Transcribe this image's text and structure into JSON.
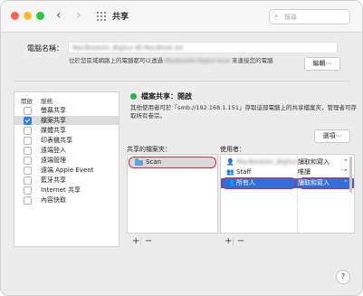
{
  "toolbar": {
    "title": "共享",
    "back_glyph": "‹",
    "forward_glyph": "›",
    "search_placeholder": "搜尋"
  },
  "computer_name": {
    "label": "電腦名稱：",
    "value": "MacBookAir_BigSur 的 MacBook Air",
    "description_prefix": "位於您區域網路上的電腦都可以透過",
    "hostname": "MacBookAir-BigSur.local",
    "description_suffix": "來連接您的電腦",
    "edit_button": "編輯⋯"
  },
  "services": {
    "header_on": "開啟",
    "header_service": "服務",
    "items": [
      {
        "label": "螢幕共享",
        "checked": false,
        "selected": false
      },
      {
        "label": "檔案共享",
        "checked": true,
        "selected": true
      },
      {
        "label": "媒體共享",
        "checked": false,
        "selected": false
      },
      {
        "label": "印表機共享",
        "checked": false,
        "selected": false
      },
      {
        "label": "遠端登入",
        "checked": false,
        "selected": false
      },
      {
        "label": "遠端管理",
        "checked": false,
        "selected": false
      },
      {
        "label": "遠端 Apple Event",
        "checked": false,
        "selected": false
      },
      {
        "label": "藍牙共享",
        "checked": false,
        "selected": false
      },
      {
        "label": "Internet 共享",
        "checked": false,
        "selected": false
      },
      {
        "label": "內容快取",
        "checked": false,
        "selected": false
      }
    ]
  },
  "status": {
    "text": "檔案共享：開啟",
    "description": "其他使用者可於「smb://192.168.1.151」存取這部電腦上的共享檔案夾，管理者可存取所有卷宗。",
    "options_button": "選項⋯",
    "color": "#2bb24c"
  },
  "shared_folders": {
    "label": "共享的檔案夾：",
    "items": [
      {
        "name": "Scan"
      }
    ],
    "add": "+",
    "remove": "−"
  },
  "users": {
    "label": "使用者：",
    "rows": [
      {
        "name": "MacBookAir_BigSur",
        "permission": "讀取和寫入",
        "icon": "person-icon"
      },
      {
        "name": "Staff",
        "permission": "唯讀",
        "icon": "group-icon"
      },
      {
        "name": "所有人",
        "permission": "讀取和寫入",
        "icon": "group-icon"
      }
    ],
    "add": "+",
    "remove": "−"
  },
  "help": "?",
  "colors": {
    "accent": "#2f6fe0",
    "highlight": "#d9252f"
  }
}
